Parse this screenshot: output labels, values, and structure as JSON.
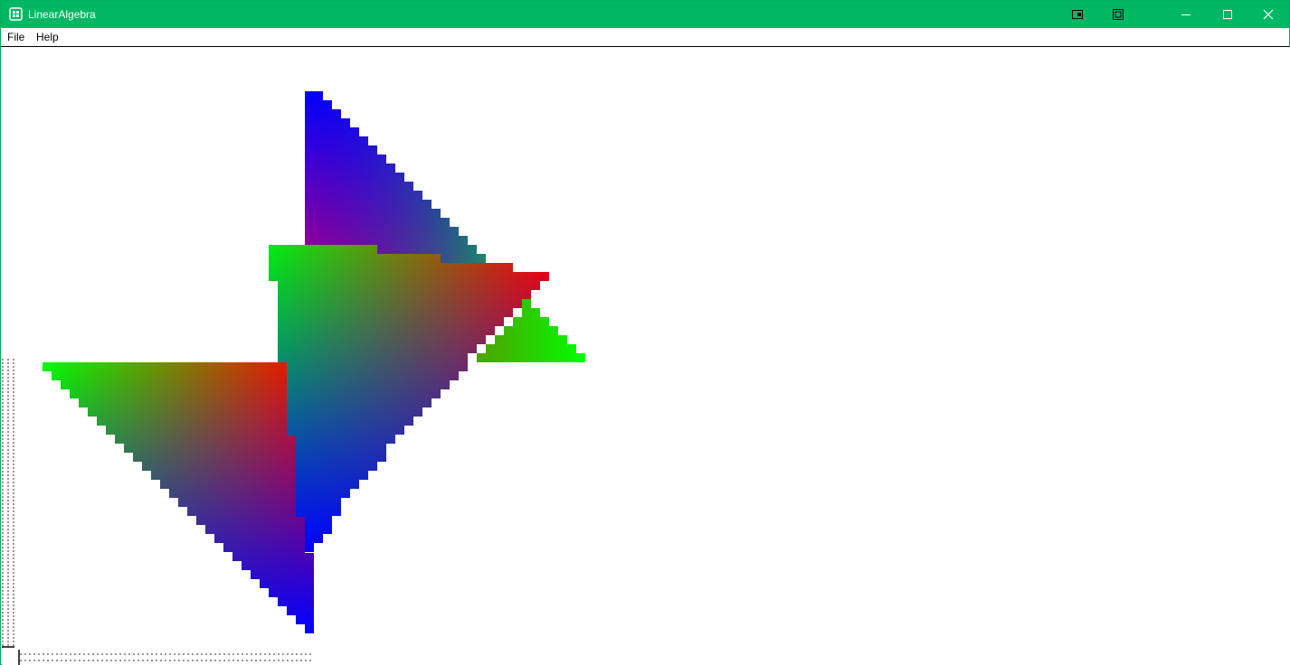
{
  "window": {
    "title": "LinearAlgebra",
    "accent_color": "#00b862"
  },
  "titlebar_buttons": [
    {
      "name": "snap-layout-button",
      "icon": "snap-icon"
    },
    {
      "name": "compact-button",
      "icon": "compact-icon"
    },
    {
      "name": "minimize-button",
      "icon": "minimize-icon"
    },
    {
      "name": "maximize-button",
      "icon": "maximize-icon"
    },
    {
      "name": "close-button",
      "icon": "close-icon"
    }
  ],
  "menu": {
    "file": "File",
    "help": "Help"
  },
  "scene": {
    "description_icons": [
      "rgb-gradient-triangles"
    ],
    "vertex_colors": [
      "#ff0000",
      "#00ff00",
      "#0000ff"
    ]
  }
}
